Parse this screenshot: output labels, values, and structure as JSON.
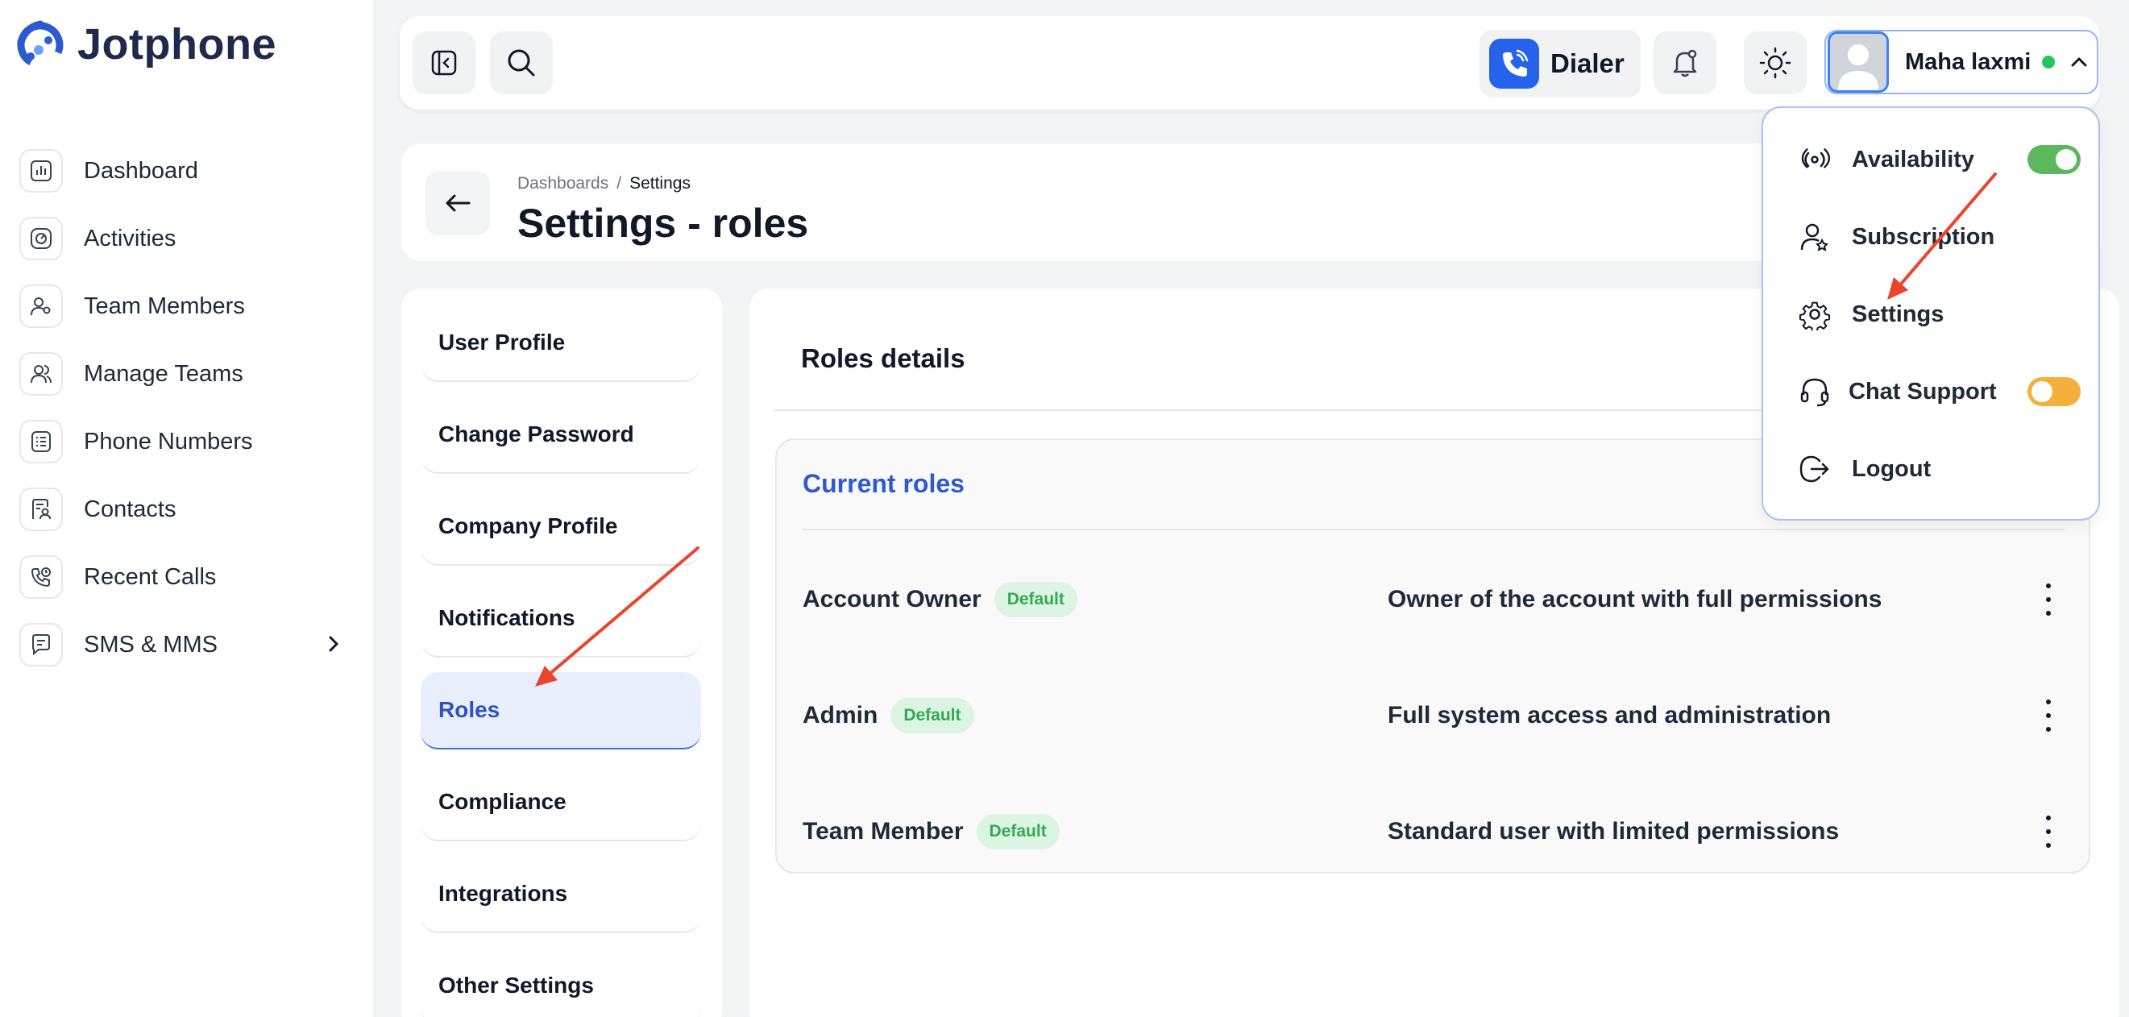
{
  "app": {
    "name": "Jotphone",
    "accent": "#2563eb"
  },
  "sidebar": {
    "items": [
      {
        "label": "Dashboard",
        "icon": "bar-chart-icon"
      },
      {
        "label": "Activities",
        "icon": "gauge-icon"
      },
      {
        "label": "Team Members",
        "icon": "user-star-icon"
      },
      {
        "label": "Manage Teams",
        "icon": "users-icon"
      },
      {
        "label": "Phone Numbers",
        "icon": "list-icon"
      },
      {
        "label": "Contacts",
        "icon": "contact-card-icon"
      },
      {
        "label": "Recent Calls",
        "icon": "phone-history-icon"
      },
      {
        "label": "SMS & MMS",
        "icon": "message-icon",
        "has_submenu": true
      }
    ]
  },
  "topbar": {
    "dialer_label": "Dialer",
    "user_name": "Maha laxmi",
    "user_status_color": "#22c55e"
  },
  "page": {
    "breadcrumb_root": "Dashboards",
    "breadcrumb_sep": "/",
    "breadcrumb_current": "Settings",
    "title": "Settings - roles"
  },
  "settings_nav": {
    "items": [
      {
        "label": "User Profile",
        "active": false
      },
      {
        "label": "Change Password",
        "active": false
      },
      {
        "label": "Company Profile",
        "active": false
      },
      {
        "label": "Notifications",
        "active": false
      },
      {
        "label": "Roles",
        "active": true
      },
      {
        "label": "Compliance",
        "active": false
      },
      {
        "label": "Integrations",
        "active": false
      },
      {
        "label": "Other Settings",
        "active": false
      }
    ]
  },
  "roles": {
    "section_title": "Roles details",
    "card_title": "Current roles",
    "rows": [
      {
        "name": "Account Owner",
        "badge": "Default",
        "description": "Owner of the account with full permissions"
      },
      {
        "name": "Admin",
        "badge": "Default",
        "description": "Full system access and administration"
      },
      {
        "name": "Team Member",
        "badge": "Default",
        "description": "Standard user with limited permissions"
      }
    ]
  },
  "user_menu": {
    "items": [
      {
        "label": "Availability",
        "icon": "broadcast-icon",
        "toggle": "on",
        "toggle_color": "#5cb85c"
      },
      {
        "label": "Subscription",
        "icon": "user-star-icon"
      },
      {
        "label": "Settings",
        "icon": "gear-icon"
      },
      {
        "label": "Chat Support",
        "icon": "headset-icon",
        "toggle": "off",
        "toggle_color": "#f5b03c"
      },
      {
        "label": "Logout",
        "icon": "logout-icon"
      }
    ]
  },
  "annotation_color": "#e8452c"
}
